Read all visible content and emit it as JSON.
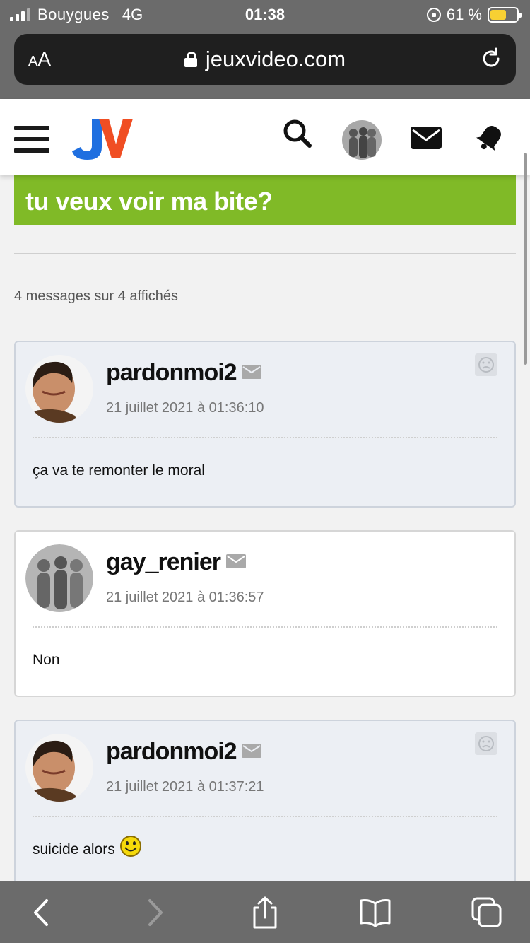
{
  "status": {
    "carrier": "Bouygues",
    "network": "4G",
    "time": "01:38",
    "battery": "61 %",
    "battery_level": 0.61
  },
  "browser": {
    "aa_label_small": "A",
    "aa_label_large": "A",
    "url": "jeuxvideo.com"
  },
  "site": {
    "logo_text": "JV"
  },
  "topic": {
    "title": "tu veux voir ma bite?",
    "message_count": "4 messages sur 4 affichés"
  },
  "posts": [
    {
      "username": "pardonmoi2",
      "date": "21 juillet 2021 à 01:36:10",
      "text": "ça va te remonter le moral",
      "avatar": "photo-avatar"
    },
    {
      "username": "gay_renier",
      "date": "21 juillet 2021 à 01:36:57",
      "text": "Non",
      "avatar": "default-silhouette-avatar"
    },
    {
      "username": "pardonmoi2",
      "date": "21 juillet 2021 à 01:37:21",
      "text": "suicide alors",
      "avatar": "photo-avatar",
      "emoji": "smiley"
    }
  ],
  "colors": {
    "brand_green": "#80ba27",
    "logo_blue": "#1f6fe0",
    "logo_orange": "#f04e23",
    "chrome_gray": "#6b6b6b"
  },
  "icons": [
    "menu-icon",
    "search-icon",
    "avatar-icon",
    "mail-icon",
    "bell-icon",
    "back-icon",
    "forward-icon",
    "share-icon",
    "bookmarks-icon",
    "tabs-icon"
  ]
}
